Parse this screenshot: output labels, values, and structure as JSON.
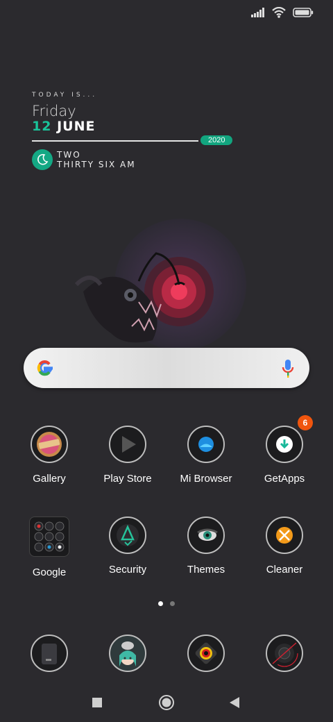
{
  "status_bar": {
    "icons": [
      "signal-icon",
      "wifi-icon",
      "battery-icon"
    ]
  },
  "widget": {
    "today_label": "TODAY IS...",
    "day": "Friday",
    "date_num": "12",
    "date_month": "JUNE",
    "year": "2020",
    "time_line1": "TWO",
    "time_line2": "THIRTY SIX AM",
    "accent": "#14a884"
  },
  "search": {
    "icons": [
      "google-g-icon",
      "microphone-icon"
    ]
  },
  "apps_row1": [
    {
      "label": "Gallery"
    },
    {
      "label": "Play Store"
    },
    {
      "label": "Mi Browser"
    },
    {
      "label": "GetApps",
      "badge": "6"
    }
  ],
  "apps_row2": [
    {
      "label": "Google"
    },
    {
      "label": "Security"
    },
    {
      "label": "Themes"
    },
    {
      "label": "Cleaner"
    }
  ],
  "page_indicator": {
    "pages": 2,
    "current": 1
  },
  "dock": {
    "icons": [
      "phone-app-icon",
      "anime-avatar-icon",
      "camera-eye-icon",
      "record-icon"
    ]
  },
  "nav": {
    "icons": [
      "recents-square-icon",
      "home-circle-icon",
      "back-triangle-icon"
    ]
  }
}
